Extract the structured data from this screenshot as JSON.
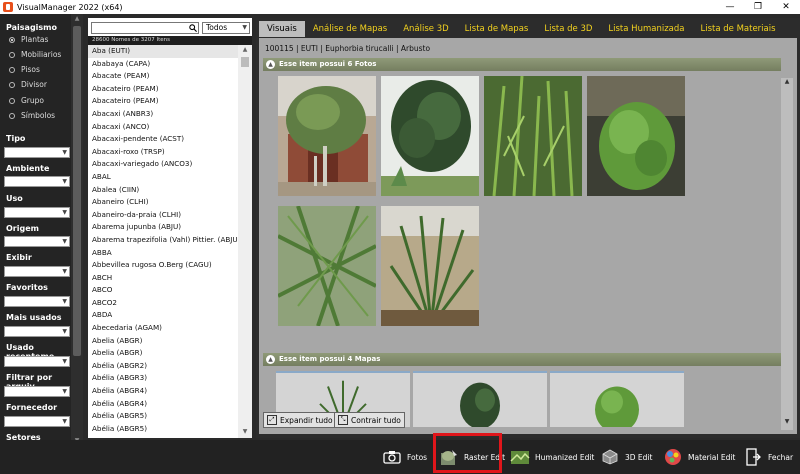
{
  "window": {
    "title": "VisualManager 2022 (x64)",
    "min": "—",
    "max": "❐",
    "close": "✕"
  },
  "sidebar": {
    "sections": [
      {
        "title": "Paisagismo",
        "options": [
          "Plantas",
          "Mobiliarios",
          "Pisos",
          "Divisor",
          "Grupo",
          "Símbolos"
        ],
        "selected": 0
      },
      {
        "title": "Tipo"
      },
      {
        "title": "Ambiente"
      },
      {
        "title": "Uso"
      },
      {
        "title": "Origem"
      },
      {
        "title": "Exibir"
      },
      {
        "title": "Favoritos"
      },
      {
        "title": "Mais usados"
      },
      {
        "title": "Usado recenteme"
      },
      {
        "title": "Filtrar por arquiv"
      },
      {
        "title": "Fornecedor"
      },
      {
        "title": "Setores"
      }
    ]
  },
  "list": {
    "search_value": "",
    "filter": "Todos",
    "count": "28600 Nomes de 3207 Itens",
    "items": [
      "Aba (EUTI)",
      "Ababaya (CAPA)",
      "Abacate (PEAM)",
      "Abacateiro (PEAM)",
      "Abacateiro (PEAM)",
      "Abacaxi (ANBR3)",
      "Abacaxi (ANCO)",
      "Abacaxi-pendente (ACST)",
      "Abacaxi-roxo (TRSP)",
      "Abacaxi-variegado (ANCO3)",
      "ABAL",
      "Abalea (CIIN)",
      "Abaneiro (CLHI)",
      "Abaneiro-da-praia (CLHI)",
      "Abarema jupunba (ABJU)",
      "Abarema trapezifolia (Vahl) Pittier. (ABJU)",
      "ABBA",
      "Abbevillea rugosa O.Berg (CAGU)",
      "ABCH",
      "ABCO",
      "ABCO2",
      "ABDA",
      "Abecedaria (AGAM)",
      "Abelia (ABGR)",
      "Abelia (ABGR)",
      "Abélia (ABGR2)",
      "Abélia (ABGR3)",
      "Abélia (ABGR4)",
      "Abélia (ABGR4)",
      "Abélia (ABGR5)",
      "Abélia (ABGR5)"
    ],
    "selected_index": 0
  },
  "tabs": [
    "Visuais",
    "Análise de Mapas",
    "Análise 3D",
    "Lista de Mapas",
    "Lista de 3D",
    "Lista Humanizada",
    "Lista de Materiais"
  ],
  "active_tab": 0,
  "content": {
    "breadcrumb": "100115 | EUTI | Euphorbia tirucalli | Arbusto",
    "photos_header": "Esse item possui  6 Fotos",
    "maps_header": "Esse item possui  4 Mapas",
    "expand_label": "Expandir tudo",
    "collapse_label": "Contrair tudo"
  },
  "toolbar": [
    {
      "label": "Fotos",
      "icon": "camera-icon"
    },
    {
      "label": "Raster Edit",
      "icon": "raster-edit-icon"
    },
    {
      "label": "Humanized Edit",
      "icon": "humanized-edit-icon"
    },
    {
      "label": "3D Edit",
      "icon": "3d-edit-icon"
    },
    {
      "label": "Material Edit",
      "icon": "material-edit-icon"
    },
    {
      "label": "Fechar",
      "icon": "close-door-icon"
    }
  ],
  "colors": {
    "tab_text": "#f3d21f",
    "highlight": "#e0161b",
    "section_bar": "#7f8a68"
  }
}
